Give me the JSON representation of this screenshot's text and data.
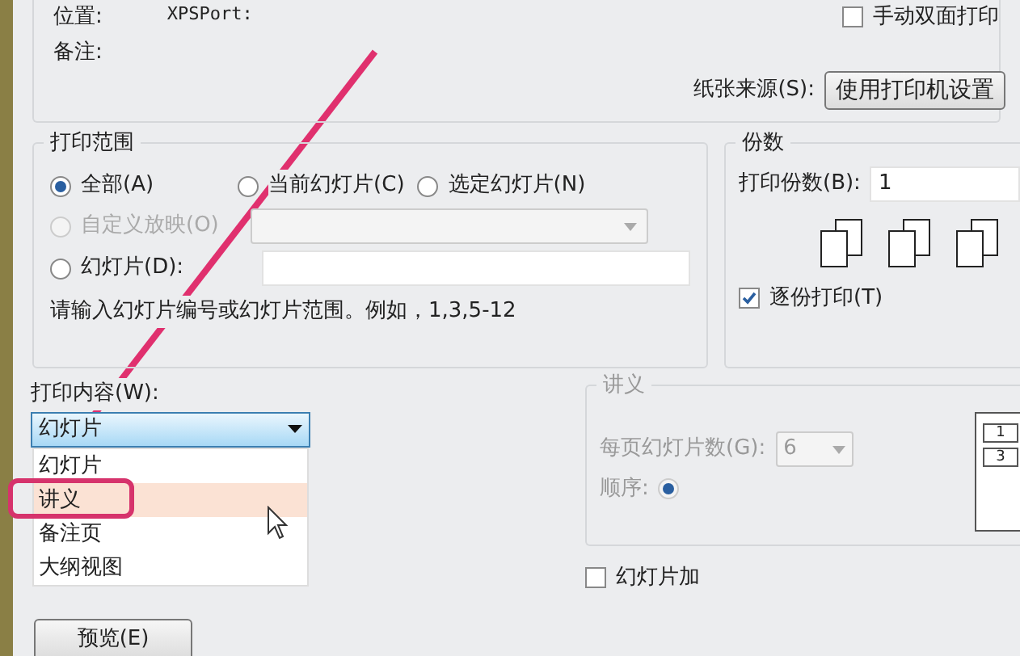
{
  "printer": {
    "location_label": "位置:",
    "location_value": "XPSPort:",
    "comment_label": "备注:",
    "duplex": {
      "label": "手动双面打印",
      "checked": false
    },
    "paper_source_label": "纸张来源(S):",
    "paper_source_button": "使用打印机设置"
  },
  "print_range": {
    "title": "打印范围",
    "options": [
      {
        "label": "全部(A)",
        "selected": true,
        "disabled": false
      },
      {
        "label": "当前幻灯片(C)",
        "selected": false,
        "disabled": false
      },
      {
        "label": "选定幻灯片(N)",
        "selected": false,
        "disabled": false
      },
      {
        "label": "自定义放映(O)",
        "selected": false,
        "disabled": true
      },
      {
        "label": "幻灯片(D):",
        "selected": false,
        "disabled": false
      }
    ],
    "hint": "请输入幻灯片编号或幻灯片范围。例如，1,3,5-12"
  },
  "copies": {
    "title": "份数",
    "count_label": "打印份数(B):",
    "count_value": "1",
    "collate": {
      "label": "逐份打印(T)",
      "checked": true
    }
  },
  "print_what": {
    "label": "打印内容(W):",
    "value": "幻灯片",
    "options": [
      {
        "label": "幻灯片",
        "highlighted": false
      },
      {
        "label": "讲义",
        "highlighted": true
      },
      {
        "label": "备注页",
        "highlighted": false
      },
      {
        "label": "大纲视图",
        "highlighted": false
      }
    ]
  },
  "handouts": {
    "title": "讲义",
    "per_page_label": "每页幻灯片数(G):",
    "per_page_value": "6",
    "order_label": "顺序:",
    "order_selected": true,
    "preview_numbers": [
      "1",
      "3"
    ]
  },
  "frame_checkbox": {
    "label": "幻灯片加",
    "checked": false
  },
  "preview_button": "预览(E)"
}
